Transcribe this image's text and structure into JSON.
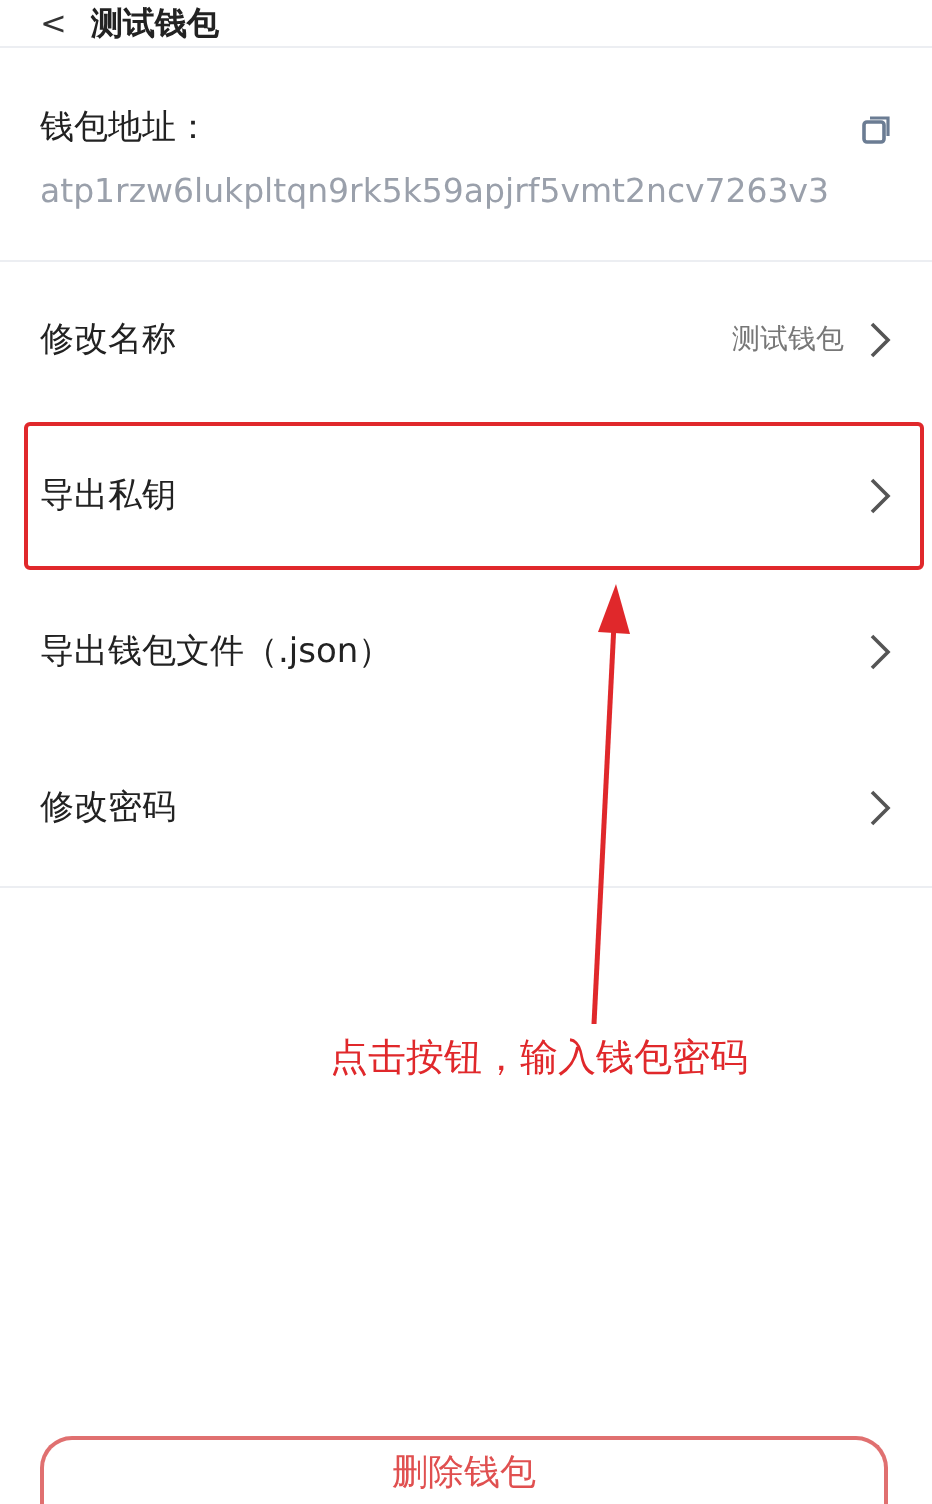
{
  "header": {
    "back": "<",
    "title": "测试钱包"
  },
  "address": {
    "label": "钱包地址：",
    "value": "atp1rzw6lukpltqn9rk5k59apjrf5vmt2ncv7263v3"
  },
  "rows": [
    {
      "label": "修改名称",
      "value": "测试钱包",
      "highlighted": false
    },
    {
      "label": "导出私钥",
      "highlighted": true
    },
    {
      "label": "导出钱包文件（.json）",
      "highlighted": false
    },
    {
      "label": "修改密码",
      "highlighted": false
    }
  ],
  "annotation": {
    "text": "点击按钮，输入钱包密码"
  },
  "delete_button": "删除钱包"
}
